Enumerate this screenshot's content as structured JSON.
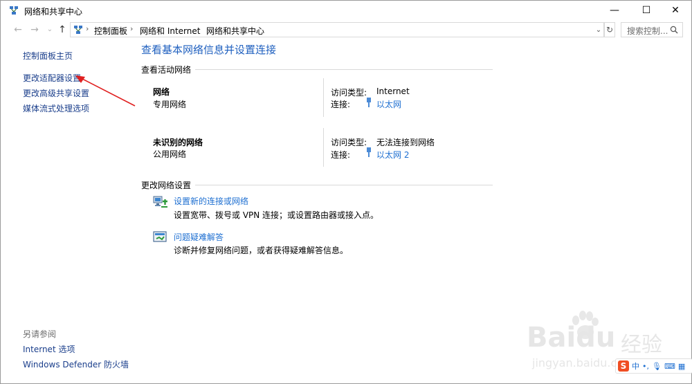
{
  "window": {
    "title": "网络和共享中心",
    "min_glyph": "—",
    "max_glyph": "☐",
    "close_glyph": "✕"
  },
  "nav": {
    "back_glyph": "←",
    "forward_glyph": "→",
    "recent_glyph": "⌄",
    "up_glyph": "↑",
    "breadcrumbs": [
      "控制面板",
      "网络和 Internet",
      "网络和共享中心"
    ],
    "sep_glyph": "›",
    "dropdown_glyph": "⌄",
    "refresh_glyph": "↻",
    "search_placeholder": "搜索控制..."
  },
  "sidebar": {
    "links": [
      "控制面板主页",
      "更改适配器设置",
      "更改高级共享设置",
      "媒体流式处理选项"
    ],
    "see_also_heading": "另请参阅",
    "see_also": [
      "Internet 选项",
      "Windows Defender 防火墙"
    ]
  },
  "main": {
    "title": "查看基本网络信息并设置连接",
    "active_networks_heading": "查看活动网络",
    "networks": [
      {
        "name": "网络",
        "type": "专用网络",
        "access_label": "访问类型:",
        "access_value": "Internet",
        "conn_label": "连接:",
        "conn_value": "以太网"
      },
      {
        "name": "未识别的网络",
        "type": "公用网络",
        "access_label": "访问类型:",
        "access_value": "无法连接到网络",
        "conn_label": "连接:",
        "conn_value": "以太网 2"
      }
    ],
    "change_settings_heading": "更改网络设置",
    "tasks": [
      {
        "link": "设置新的连接或网络",
        "desc": "设置宽带、拨号或 VPN 连接；或设置路由器或接入点。",
        "icon": "network-setup-icon"
      },
      {
        "link": "问题疑难解答",
        "desc": "诊断并修复网络问题，或者获得疑难解答信息。",
        "icon": "troubleshoot-icon"
      }
    ]
  },
  "watermark": {
    "brand": "Baidu",
    "brand_cn": "经验",
    "url": "jingyan.baidu.com"
  },
  "ime": {
    "logo": "S",
    "lang": "中",
    "punct": "•,",
    "voice": "🎙",
    "keyboard": "⌨",
    "more": "▦"
  },
  "colors": {
    "link": "#1e6fd1",
    "nav_link": "#1a3e8b",
    "title_blue": "#1e5fbf",
    "annotation_arrow": "#e02020"
  }
}
